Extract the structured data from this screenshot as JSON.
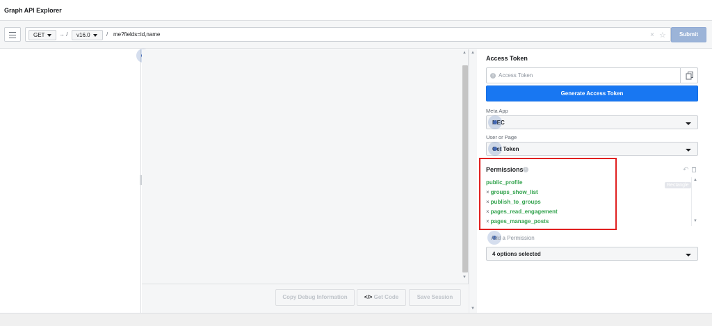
{
  "app": {
    "title": "Graph API Explorer"
  },
  "query": {
    "method": "GET",
    "arrow": "→ /",
    "version": "v16.0",
    "slash": "/",
    "path": "me?fields=id,name",
    "clear_icon": "×",
    "star_icon": "☆",
    "submit_label": "Submit"
  },
  "editor": {
    "copy_debug_label": "Copy Debug Information",
    "get_code_glyph": "</>",
    "get_code_label": "Get Code",
    "save_session_label": "Save Session"
  },
  "access_token": {
    "title": "Access Token",
    "placeholder": "Access Token",
    "copy_icon": "copy-icon",
    "generate_label": "Generate Access Token"
  },
  "meta_app": {
    "label": "Meta App",
    "value": "MEC"
  },
  "user_or_page": {
    "label": "User or Page",
    "value": "Get Token"
  },
  "permissions": {
    "title": "Permissions",
    "info_icon": "info-icon",
    "undo_icon": "undo-icon",
    "trash_icon": "trash-icon",
    "items": [
      {
        "name": "public_profile",
        "removable": false
      },
      {
        "name": "groups_show_list",
        "removable": true
      },
      {
        "name": "publish_to_groups",
        "removable": true
      },
      {
        "name": "pages_read_engagement",
        "removable": true
      },
      {
        "name": "pages_manage_posts",
        "removable": true
      }
    ],
    "tooltip": "Rectangle",
    "add_placeholder": "Add a Permission",
    "options_selected": "4 options selected"
  },
  "colors": {
    "accent": "#1877f2",
    "permission_green": "#31a24c",
    "highlight": "#e02020"
  }
}
